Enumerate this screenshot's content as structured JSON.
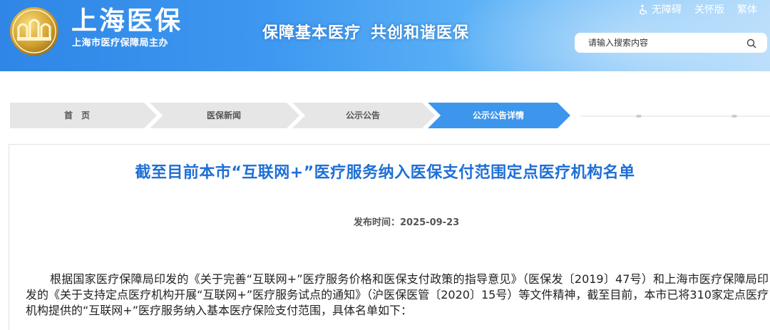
{
  "header": {
    "site_title": "上海医保",
    "site_subtitle": "上海市医疗保障局主办",
    "slogan_part1": "保障基本医疗",
    "slogan_part2": "共创和谐医保",
    "links": {
      "accessibility": "无障碍",
      "care_version": "关怀版",
      "traditional": "繁体"
    },
    "search": {
      "placeholder": "请输入搜索内容"
    }
  },
  "breadcrumb": {
    "items": [
      {
        "label": "首　页"
      },
      {
        "label": "医保新闻"
      },
      {
        "label": "公示公告"
      },
      {
        "label": "公示公告详情"
      }
    ]
  },
  "article": {
    "title": "截至目前本市“互联网+”医疗服务纳入医保支付范围定点医疗机构名单",
    "date": "发布时间：2025-09-23",
    "body": "根据国家医疗保障局印发的《关于完善“互联网+”医疗服务价格和医保支付政策的指导意见》（医保发〔2019〕47号）和上海市医疗保障局印发的《关于支持定点医疗机构开展“互联网+”医疗服务试点的通知》（沪医保医管〔2020〕15号）等文件精神，截至目前，本市已将310家定点医疗机构提供的“互联网+”医疗服务纳入基本医疗保险支付范围，具体名单如下："
  },
  "colors": {
    "header_start": "#2f86e6",
    "header_end": "#b7ddfb",
    "title_blue": "#1f6fd6",
    "crumb_active": "#3d95ec",
    "crumb_inactive": "#e6e6e6",
    "logo_gold": "#d4a332"
  },
  "icons": {
    "logo": "shanghai-medical-insurance-emblem",
    "accessibility": "wheelchair-icon",
    "search": "search-icon"
  }
}
